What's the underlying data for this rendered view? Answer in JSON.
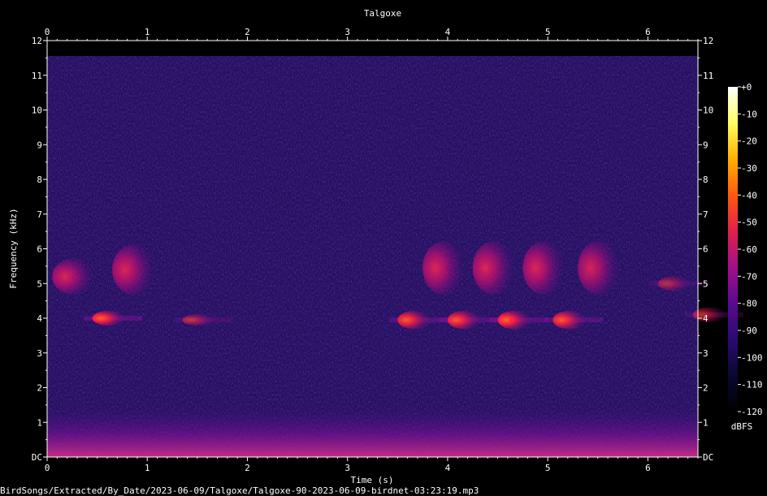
{
  "chart_data": {
    "type": "heatmap",
    "title": "Talgoxe",
    "xlabel": "Time (s)",
    "ylabel": "Frequency (kHz)",
    "xlim": [
      0,
      6.5
    ],
    "ylim": [
      0,
      12
    ],
    "x_ticks": [
      "0",
      "1",
      "2",
      "3",
      "4",
      "5",
      "6"
    ],
    "y_ticks": [
      "DC",
      "1",
      "2",
      "3",
      "4",
      "5",
      "6",
      "7",
      "8",
      "9",
      "10",
      "11",
      "12"
    ],
    "colorbar": {
      "label": "dBFS",
      "range": [
        -120,
        0
      ],
      "ticks": [
        "+0",
        "-10",
        "-20",
        "-30",
        "-40",
        "-50",
        "-60",
        "-70",
        "-80",
        "-90",
        "-100",
        "-110",
        "-120"
      ],
      "colors": [
        "#000000",
        "#0a0830",
        "#2a0a70",
        "#5a0a90",
        "#a0108a",
        "#e0204a",
        "#ff5a10",
        "#ffb000",
        "#ffff60",
        "#ffffff"
      ]
    },
    "events": [
      {
        "t": 0.05,
        "f_low": 4.8,
        "f_high": 5.6,
        "peak_db": -70
      },
      {
        "t": 0.45,
        "f_low": 3.9,
        "f_high": 4.1,
        "peak_db": -60
      },
      {
        "t": 0.65,
        "f_low": 4.8,
        "f_high": 6.0,
        "peak_db": -70
      },
      {
        "t": 1.35,
        "f_low": 3.9,
        "f_high": 4.0,
        "peak_db": -85
      },
      {
        "t": 3.5,
        "f_low": 3.8,
        "f_high": 4.1,
        "peak_db": -65
      },
      {
        "t": 3.75,
        "f_low": 4.8,
        "f_high": 6.1,
        "peak_db": -70
      },
      {
        "t": 4.0,
        "f_low": 3.8,
        "f_high": 4.1,
        "peak_db": -65
      },
      {
        "t": 4.25,
        "f_low": 4.8,
        "f_high": 6.1,
        "peak_db": -70
      },
      {
        "t": 4.5,
        "f_low": 3.8,
        "f_high": 4.1,
        "peak_db": -60
      },
      {
        "t": 4.75,
        "f_low": 4.8,
        "f_high": 6.1,
        "peak_db": -70
      },
      {
        "t": 5.05,
        "f_low": 3.8,
        "f_high": 4.1,
        "peak_db": -65
      },
      {
        "t": 5.3,
        "f_low": 4.8,
        "f_high": 6.1,
        "peak_db": -72
      },
      {
        "t": 6.1,
        "f_low": 4.9,
        "f_high": 5.1,
        "peak_db": -90
      },
      {
        "t": 6.45,
        "f_low": 4.0,
        "f_high": 4.2,
        "peak_db": -85
      }
    ]
  },
  "footer": {
    "filename": "BirdSongs/Extracted/By_Date/2023-06-09/Talgoxe/Talgoxe-90-2023-06-09-birdnet-03:23:19.mp3"
  }
}
